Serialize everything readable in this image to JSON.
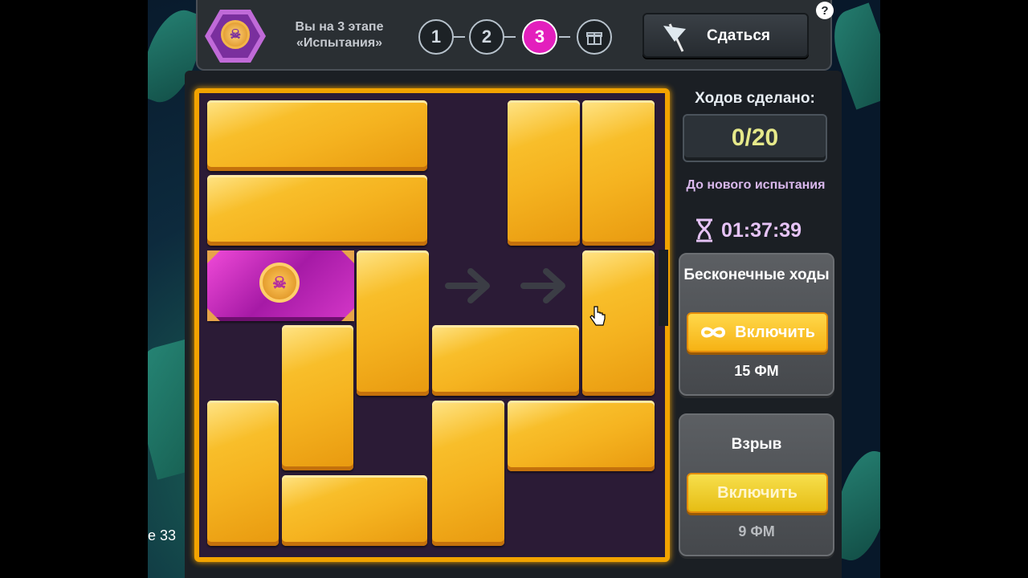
{
  "header": {
    "stage_text": "Вы на 3 этапе «Испытания»",
    "steps": [
      "1",
      "2",
      "3"
    ],
    "active_step": "3",
    "give_up_label": "Сдаться",
    "help_label": "?"
  },
  "sidebar": {
    "moves_title": "Ходов сделано:",
    "moves_value": "0/20",
    "new_trial_label": "До нового испытания",
    "timer": "01:37:39",
    "infinite_moves": {
      "title": "Бесконечные ходы",
      "button_label": "Включить",
      "price": "15 ФМ"
    },
    "explosion": {
      "title": "Взрыв",
      "button_label": "Включить",
      "price": "9 ФМ"
    }
  },
  "overlay_text": "e 33",
  "colors": {
    "accent": "#e31fbd",
    "gold": "#f2a300",
    "block": "#f5b320",
    "key": "#c42ab8"
  }
}
